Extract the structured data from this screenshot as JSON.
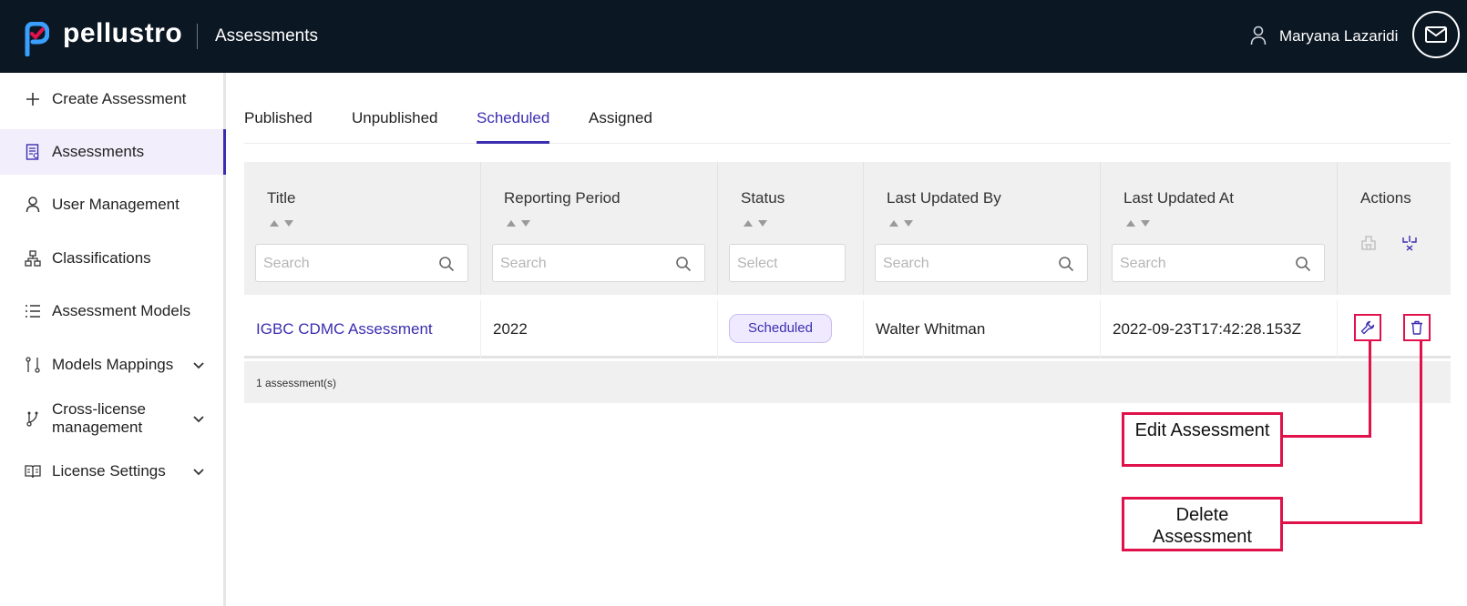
{
  "header": {
    "brand": "pellustro",
    "page_title": "Assessments",
    "user_name": "Maryana Lazaridi",
    "colors": {
      "bg": "#0b1723",
      "accent": "#3b2db0"
    }
  },
  "sidebar": {
    "items": [
      {
        "label": "Create Assessment",
        "icon": "plus-icon"
      },
      {
        "label": "Assessments",
        "icon": "assessment-doc-icon",
        "active": true
      },
      {
        "label": "User Management",
        "icon": "user-icon"
      },
      {
        "label": "Classifications",
        "icon": "hierarchy-icon"
      },
      {
        "label": "Assessment Models",
        "icon": "list-icon"
      },
      {
        "label": "Models Mappings",
        "icon": "mapping-icon",
        "expandable": true
      },
      {
        "label": "Cross-license management",
        "icon": "branch-icon",
        "expandable": true
      },
      {
        "label": "License Settings",
        "icon": "book-icon",
        "expandable": true
      }
    ]
  },
  "tabs": [
    {
      "label": "Published"
    },
    {
      "label": "Unpublished"
    },
    {
      "label": "Scheduled",
      "active": true
    },
    {
      "label": "Assigned"
    }
  ],
  "table": {
    "columns": [
      {
        "label": "Title",
        "placeholder": "Search"
      },
      {
        "label": "Reporting Period",
        "placeholder": "Search"
      },
      {
        "label": "Status",
        "placeholder": "Select"
      },
      {
        "label": "Last Updated By",
        "placeholder": "Search"
      },
      {
        "label": "Last Updated At",
        "placeholder": "Search"
      },
      {
        "label": "Actions"
      }
    ],
    "rows": [
      {
        "title": "IGBC CDMC Assessment",
        "reporting_period": "2022",
        "status": "Scheduled",
        "last_updated_by": "Walter Whitman",
        "last_updated_at": "2022-09-23T17:42:28.153Z"
      }
    ],
    "footer": "1 assessment(s)"
  },
  "callouts": {
    "edit": "Edit Assessment",
    "delete": "Delete Assessment"
  }
}
